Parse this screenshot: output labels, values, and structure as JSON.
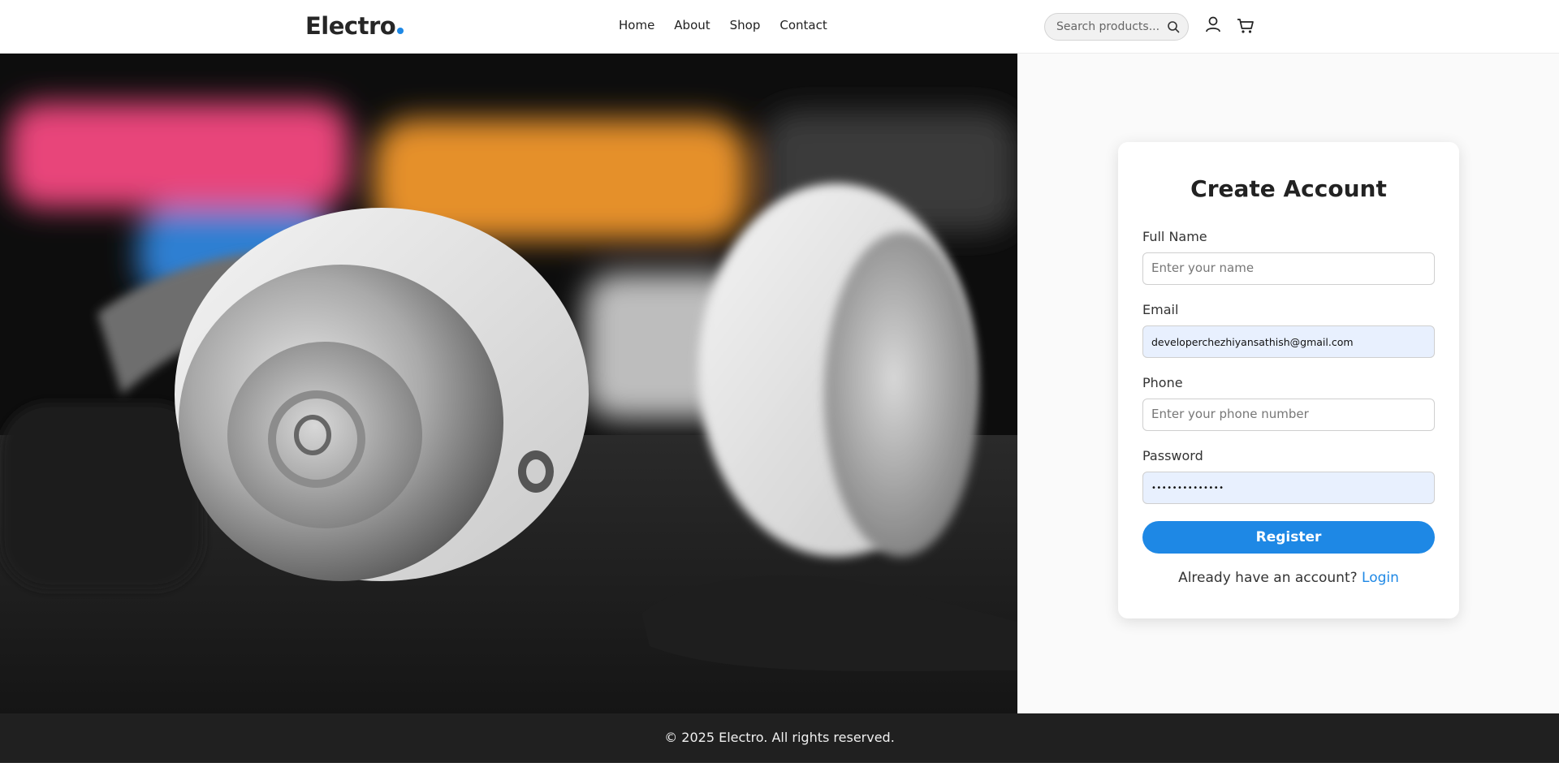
{
  "header": {
    "logo": "Electro",
    "nav": [
      "Home",
      "About",
      "Shop",
      "Contact"
    ],
    "search_placeholder": "Search products...",
    "accent_color": "#1e88e5"
  },
  "form": {
    "title": "Create Account",
    "full_name": {
      "label": "Full Name",
      "placeholder": "Enter your name",
      "value": ""
    },
    "email": {
      "label": "Email",
      "value": "developerchezhiyansathish@gmail.com"
    },
    "phone": {
      "label": "Phone",
      "placeholder": "Enter your phone number",
      "value": ""
    },
    "password": {
      "label": "Password",
      "value": "••••••••••••••"
    },
    "register_label": "Register",
    "login_prompt": "Already have an account?",
    "login_link": "Login"
  },
  "footer": {
    "text": "© 2025 Electro. All rights reserved."
  }
}
